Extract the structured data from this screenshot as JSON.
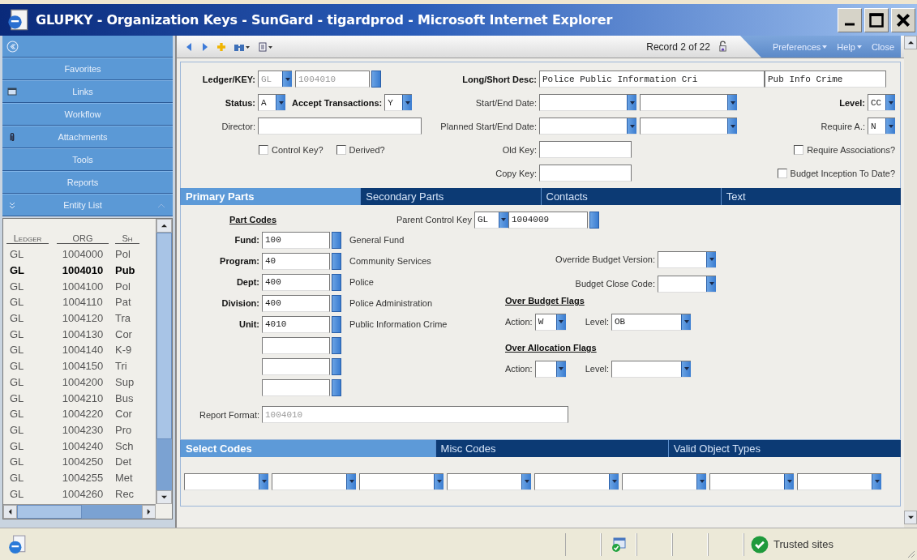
{
  "window": {
    "title": "GLUPKY - Organization Keys - SunGard - tigardprod - Microsoft Internet Explorer"
  },
  "sidebar": {
    "menu": [
      {
        "label": "Favorites"
      },
      {
        "label": "Links"
      },
      {
        "label": "Workflow"
      },
      {
        "label": "Attachments"
      },
      {
        "label": "Tools"
      },
      {
        "label": "Reports"
      },
      {
        "label": "Entity List"
      }
    ],
    "list": {
      "columns": [
        "Ledger",
        "ORG",
        "Sh"
      ],
      "rows": [
        {
          "cells": [
            "GL",
            "1004000",
            "Pol"
          ],
          "selected": false
        },
        {
          "cells": [
            "GL",
            "1004010",
            "Pub"
          ],
          "selected": true
        },
        {
          "cells": [
            "GL",
            "1004100",
            "Pol"
          ],
          "selected": false
        },
        {
          "cells": [
            "GL",
            "1004110",
            "Pat"
          ],
          "selected": false
        },
        {
          "cells": [
            "GL",
            "1004120",
            "Tra"
          ],
          "selected": false
        },
        {
          "cells": [
            "GL",
            "1004130",
            "Cor"
          ],
          "selected": false
        },
        {
          "cells": [
            "GL",
            "1004140",
            "K-9"
          ],
          "selected": false
        },
        {
          "cells": [
            "GL",
            "1004150",
            "Tri"
          ],
          "selected": false
        },
        {
          "cells": [
            "GL",
            "1004200",
            "Sup"
          ],
          "selected": false
        },
        {
          "cells": [
            "GL",
            "1004210",
            "Bus"
          ],
          "selected": false
        },
        {
          "cells": [
            "GL",
            "1004220",
            "Cor"
          ],
          "selected": false
        },
        {
          "cells": [
            "GL",
            "1004230",
            "Pro"
          ],
          "selected": false
        },
        {
          "cells": [
            "GL",
            "1004240",
            "Sch"
          ],
          "selected": false
        },
        {
          "cells": [
            "GL",
            "1004250",
            "Det"
          ],
          "selected": false
        },
        {
          "cells": [
            "GL",
            "1004255",
            "Met"
          ],
          "selected": false
        },
        {
          "cells": [
            "GL",
            "1004260",
            "Rec"
          ],
          "selected": false
        }
      ]
    }
  },
  "toolbar": {
    "record": "Record 2 of 22",
    "menus": [
      {
        "label": "Preferences",
        "dropdown": true
      },
      {
        "label": "Help",
        "dropdown": true
      },
      {
        "label": "Close",
        "dropdown": false
      }
    ]
  },
  "header": {
    "ledger_key": {
      "label": "Ledger/KEY:",
      "ledger": "GL",
      "key": "1004010",
      "disabled": true
    },
    "long_short_desc": {
      "label": "Long/Short Desc:",
      "long": "Police Public Information Cri",
      "short": "Pub Info Crime"
    },
    "status": {
      "label": "Status:",
      "value": "A"
    },
    "accept_transactions": {
      "label": "Accept Transactions:",
      "value": "Y"
    },
    "start_end_date": {
      "label": "Start/End Date:"
    },
    "level": {
      "label": "Level:",
      "value": "CC"
    },
    "director": {
      "label": "Director:"
    },
    "planned_start_end_date": {
      "label": "Planned Start/End Date:"
    },
    "require_a": {
      "label": "Require A.:",
      "value": "N"
    },
    "control_key": {
      "label": "Control Key?",
      "checked": false
    },
    "derived": {
      "label": "Derived?",
      "checked": false
    },
    "old_key": {
      "label": "Old Key:"
    },
    "copy_key": {
      "label": "Copy Key:"
    },
    "require_associations": {
      "label": "Require Associations?",
      "checked": false
    },
    "budget_inception_to_date": {
      "label": "Budget Inception To Date?",
      "checked": false
    }
  },
  "tabs": [
    {
      "label": "Primary Parts",
      "selected": true
    },
    {
      "label": "Secondary Parts",
      "selected": false
    },
    {
      "label": "Contacts",
      "selected": false
    },
    {
      "label": "Text",
      "selected": false
    }
  ],
  "primary_parts": {
    "part_codes_title": "Part Codes",
    "parts": [
      {
        "kind": "code",
        "label": "Fund:",
        "value": "100",
        "description": "General Fund"
      },
      {
        "kind": "code",
        "label": "Program:",
        "value": "40",
        "description": "Community Services"
      },
      {
        "kind": "code",
        "label": "Dept:",
        "value": "400",
        "description": "Police"
      },
      {
        "kind": "code",
        "label": "Division:",
        "value": "400",
        "description": "Police Administration"
      },
      {
        "kind": "code",
        "label": "Unit:",
        "value": "4010",
        "description": "Public Information Crime"
      },
      {
        "kind": "blank"
      },
      {
        "kind": "blank"
      },
      {
        "kind": "blank"
      }
    ],
    "parent_control_key": {
      "label": "Parent Control Key",
      "ledger": "GL",
      "key": "1004009"
    },
    "override_budget_version": {
      "label": "Override Budget Version:"
    },
    "budget_close_code": {
      "label": "Budget Close Code:"
    },
    "over_budget_flags": {
      "title": "Over Budget Flags",
      "action": {
        "label": "Action:",
        "value": "W"
      },
      "level": {
        "label": "Level:",
        "value": "OB"
      }
    },
    "over_allocation_flags": {
      "title": "Over Allocation Flags",
      "action": {
        "label": "Action:"
      },
      "level": {
        "label": "Level:"
      }
    },
    "report_format": {
      "label": "Report Format:",
      "value": "1004010",
      "disabled": true
    }
  },
  "bottom_tabs": [
    {
      "label": "Select Codes",
      "selected": true
    },
    {
      "label": "Misc Codes",
      "selected": false
    },
    {
      "label": "Valid Object Types",
      "selected": false
    }
  ],
  "select_codes": [
    {
      "kind": "select"
    },
    {
      "kind": "select"
    },
    {
      "kind": "select"
    },
    {
      "kind": "select"
    },
    {
      "kind": "select"
    },
    {
      "kind": "select"
    },
    {
      "kind": "select"
    },
    {
      "kind": "select"
    }
  ],
  "status_bar": {
    "zone": "Trusted sites"
  }
}
